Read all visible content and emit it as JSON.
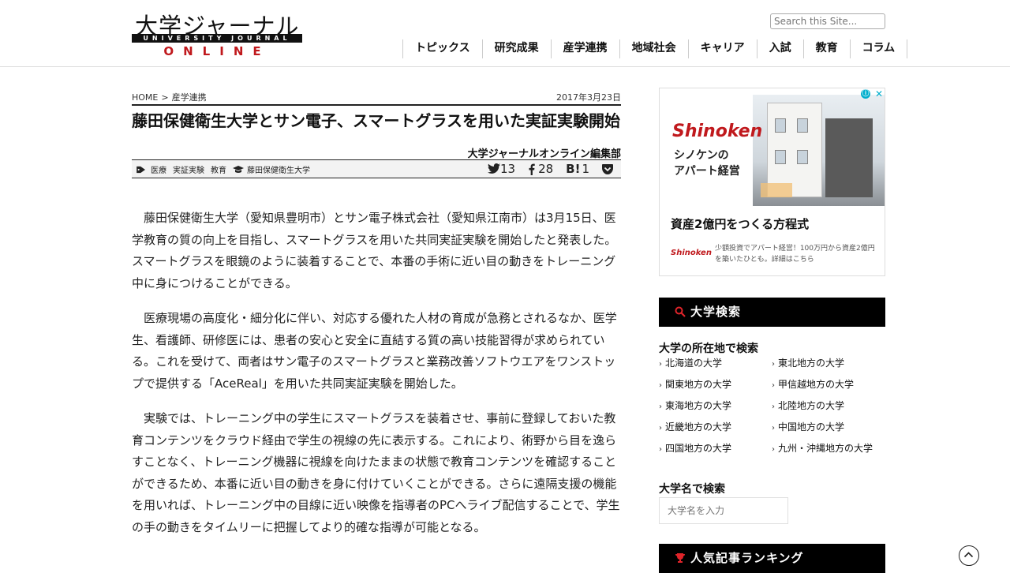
{
  "header": {
    "logo_main": "大学ジャーナル",
    "logo_bar": "UNIVERSITY JOURNAL",
    "logo_online": "ONLINE",
    "search_placeholder": "Search this Site...",
    "nav": [
      "トピックス",
      "研究成果",
      "産学連携",
      "地域社会",
      "キャリア",
      "入試",
      "教育",
      "コラム"
    ]
  },
  "article": {
    "breadcrumb_home": "HOME",
    "breadcrumb_sep": ">",
    "breadcrumb_category": "産学連携",
    "date": "2017年3月23日",
    "title": "藤田保健衛生大学とサン電子、スマートグラスを用いた実証実験開始",
    "author": "大学ジャーナルオンライン編集部",
    "tags": [
      "医療",
      "実証実験",
      "教育"
    ],
    "university_tag": "藤田保健衛生大学",
    "share": {
      "twitter_icon": "twitter-icon",
      "twitter_count": "13",
      "facebook_icon": "facebook-icon",
      "facebook_count": "28",
      "hatena_label": "B!",
      "hatena_count": "1",
      "pocket_icon": "pocket-icon"
    },
    "paragraphs": [
      "藤田保健衛生大学（愛知県豊明市）とサン電子株式会社（愛知県江南市）は3月15日、医学教育の質の向上を目指し、スマートグラスを用いた共同実証実験を開始したと発表した。スマートグラスを眼鏡のように装着することで、本番の手術に近い目の動きをトレーニング中に身につけることができる。",
      "医療現場の高度化・細分化に伴い、対応する優れた人材の育成が急務とされるなか、医学生、看護師、研修医には、患者の安心と安全に直結する質の高い技能習得が求められている。これを受けて、両者はサン電子のスマートグラスと業務改善ソフトウエアをワンストップで提供する「AceReal」を用いた共同実証実験を開始した。",
      "実験では、トレーニング中の学生にスマートグラスを装着させ、事前に登録しておいた教育コンテンツをクラウド経由で学生の視線の先に表示する。これにより、術野から目を逸らすことなく、トレーニング機器に視線を向けたままの状態で教育コンテンツを確認することができるため、本番に近い目の動きを身に付けていくことができる。さらに遠隔支援の機能を用いれば、トレーニング中の目線に近い映像を指導者のPCへライブ配信することで、学生の手の動きをタイムリーに把握してより的確な指導が可能となる。"
    ]
  },
  "ad": {
    "brand": "Shinoken",
    "line1": "シノケンの",
    "line2": "アパート経営",
    "headline": "資産2億円をつくる方程式",
    "small_logo": "Shinoken",
    "desc": "少額投資でアパート経営！100万円から資産2億円を築いたひとも。詳細はこちら",
    "info_icon": "ⓘ",
    "close_icon": "✕"
  },
  "sidebar": {
    "search_header": "大学検索",
    "location_title": "大学の所在地で検索",
    "regions": [
      "北海道の大学",
      "東北地方の大学",
      "関東地方の大学",
      "甲信越地方の大学",
      "東海地方の大学",
      "北陸地方の大学",
      "近畿地方の大学",
      "中国地方の大学",
      "四国地方の大学",
      "九州・沖縄地方の大学"
    ],
    "name_title": "大学名で検索",
    "name_placeholder": "大学名を入力",
    "ranking_header": "人気記事ランキング"
  },
  "colors": {
    "accent_red": "#c0191d",
    "header_black": "#000000"
  }
}
